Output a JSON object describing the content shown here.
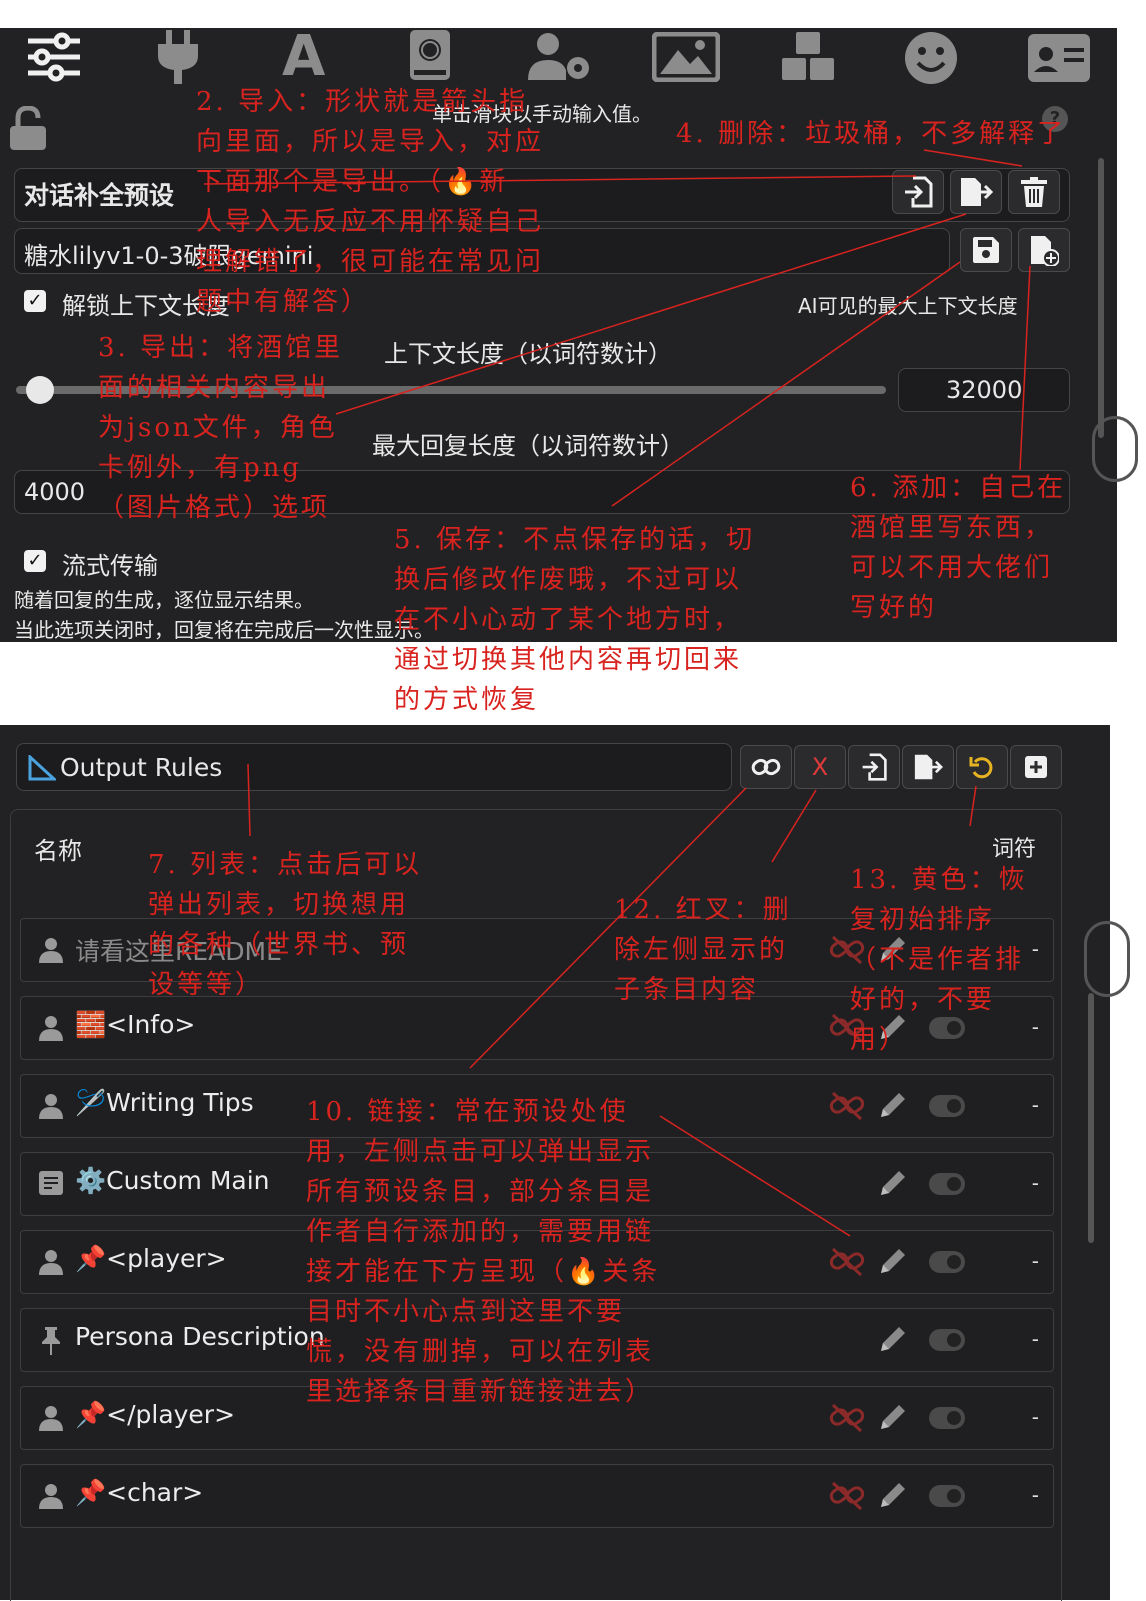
{
  "panel1": {
    "top_nav_icons": [
      "sliders-icon",
      "plug-icon",
      "font-icon",
      "book-globe-icon",
      "user-gear-icon",
      "image-icon",
      "cubes-icon",
      "smiley-icon",
      "id-card-icon"
    ],
    "click_hint": "单击滑块以手动输入值。",
    "help_mark": "?",
    "preset_label": "对话补全预设",
    "preset_value": "糖水lilyv1-0-3破限gemini",
    "unlock_context_label": "解锁上下文长度",
    "ai_visible_label": "AI可见的最大上下文长度",
    "context_length_label": "上下文长度（以词符数计）",
    "context_length_value": "32000",
    "max_reply_label": "最大回复长度（以词符数计）",
    "max_reply_value": "4000",
    "streaming_label": "流式传输",
    "streaming_desc1": "随着回复的生成，逐位显示结果。",
    "streaming_desc2": "当此选项关闭时，回复将在完成后一次性显示。"
  },
  "panel2": {
    "dropdown_icon": "triangle-ruler-icon",
    "dropdown_value": "Output Rules",
    "col_name": "名称",
    "col_tokens": "词符",
    "clear_label": "X",
    "rows": [
      {
        "icon": "user-icon",
        "name": "请看这里README",
        "dim": true,
        "link": true,
        "toggle": false,
        "tokens": "-"
      },
      {
        "icon": "user-icon",
        "name": "🧱<Info>",
        "dim": false,
        "link": true,
        "toggle": true,
        "tokens": "-"
      },
      {
        "icon": "user-icon",
        "name": "🪡Writing Tips",
        "dim": false,
        "link": true,
        "toggle": true,
        "tokens": "-"
      },
      {
        "icon": "doc-icon",
        "name": "⚙️Custom Main",
        "dim": false,
        "link": false,
        "toggle": true,
        "tokens": "-"
      },
      {
        "icon": "user-icon",
        "name": "📌<player>",
        "dim": false,
        "link": true,
        "toggle": true,
        "tokens": "-"
      },
      {
        "icon": "pin-icon",
        "name": "Persona Description",
        "dim": false,
        "link": false,
        "toggle": true,
        "tokens": "-"
      },
      {
        "icon": "user-icon",
        "name": "📌</player>",
        "dim": false,
        "link": true,
        "toggle": true,
        "tokens": "-"
      },
      {
        "icon": "user-icon",
        "name": "📌<char>",
        "dim": false,
        "link": true,
        "toggle": true,
        "tokens": "-"
      }
    ]
  },
  "annotations": {
    "n2": "2. 导入：形状就是箭头指\n向里面，所以是导入，对应\n下面那个是导出。（🔥新\n人导入无反应不用怀疑自己\n理解错了，很可能在常见问\n题中有解答）",
    "n3": "3. 导出：将酒馆里\n面的相关内容导出\n为json文件，角色\n卡例外，有png\n（图片格式）选项",
    "n4": "4. 删除：垃圾桶，不多解释了",
    "n5": "5. 保存：不点保存的话，切\n换后修改作废哦，不过可以\n在不小心动了某个地方时，\n通过切换其他内容再切回来\n的方式恢复",
    "n6": "6. 添加：自己在\n酒馆里写东西，\n可以不用大佬们\n写好的",
    "n7": "7. 列表：点击后可以\n弹出列表，切换想用\n的各种（世界书、预\n设等等）",
    "n10": "10. 链接：常在预设处使\n用，左侧点击可以弹出显示\n所有预设条目，部分条目是\n作者自行添加的，需要用链\n接才能在下方呈现（🔥关条\n目时不小心点到这里不要\n慌，没有删掉，可以在列表\n里选择条目重新链接进去）",
    "n12": "12. 红叉：删\n除左侧显示的\n子条目内容",
    "n13": "13. 黄色：恢\n复初始排序\n（不是作者排\n好的，不要\n用）"
  },
  "colors": {
    "annotation": "#d8231f",
    "reset_icon": "#e6b422",
    "clear_icon": "#e03a3a",
    "panel_bg": "#222224"
  }
}
